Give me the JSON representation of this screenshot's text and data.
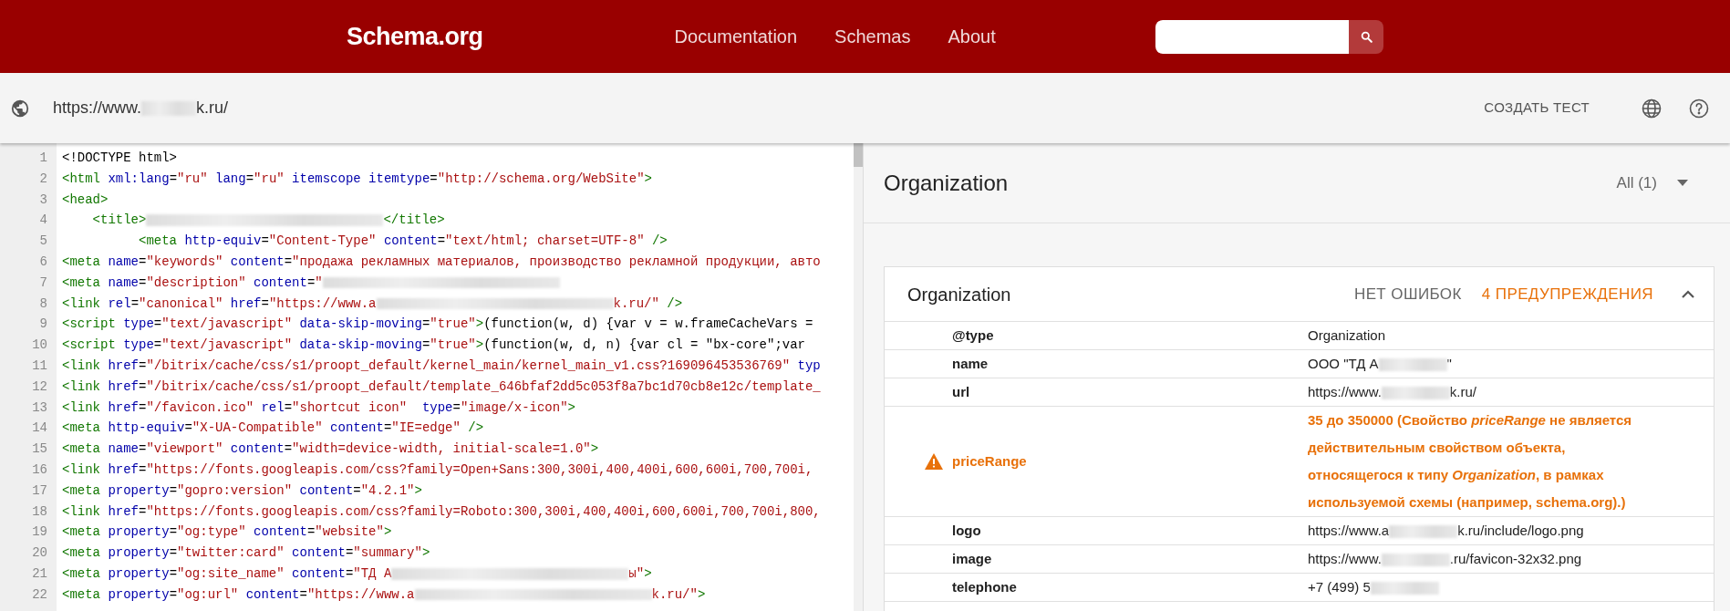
{
  "header": {
    "logo": "Schema.org",
    "nav": [
      {
        "label": "Documentation"
      },
      {
        "label": "Schemas"
      },
      {
        "label": "About"
      }
    ]
  },
  "toolbar": {
    "url": [
      {
        "kind": "text",
        "text": "https://www."
      },
      {
        "kind": "blur"
      },
      {
        "kind": "text",
        "text": "k.ru/"
      }
    ],
    "create_test": "СОЗДАТЬ ТЕСТ"
  },
  "code": {
    "lines": [
      {
        "number": "1",
        "tokens": [
          {
            "kind": "plain",
            "text": "<!DOCTYPE html>"
          }
        ]
      },
      {
        "number": "2",
        "tokens": [
          {
            "kind": "tag",
            "text": "<html"
          },
          {
            "kind": "attr",
            "text": " xml:lang"
          },
          {
            "kind": "plain",
            "text": "="
          },
          {
            "kind": "value",
            "text": "\"ru\""
          },
          {
            "kind": "attr",
            "text": " lang"
          },
          {
            "kind": "plain",
            "text": "="
          },
          {
            "kind": "value",
            "text": "\"ru\""
          },
          {
            "kind": "attr",
            "text": " itemscope"
          },
          {
            "kind": "attr",
            "text": " itemtype"
          },
          {
            "kind": "plain",
            "text": "="
          },
          {
            "kind": "value",
            "text": "\"http://schema.org/WebSite\""
          },
          {
            "kind": "tag",
            "text": ">"
          }
        ]
      },
      {
        "number": "3",
        "tokens": [
          {
            "kind": "tag",
            "text": "<head>"
          }
        ]
      },
      {
        "number": "4",
        "tokens": [
          {
            "kind": "tag",
            "text": "    <title>"
          },
          {
            "kind": "blur"
          },
          {
            "kind": "tag",
            "text": "</title>"
          }
        ]
      },
      {
        "number": "5",
        "tokens": [
          {
            "kind": "tag",
            "text": "          <meta"
          },
          {
            "kind": "attr",
            "text": " http-equiv"
          },
          {
            "kind": "plain",
            "text": "="
          },
          {
            "kind": "value",
            "text": "\"Content-Type\""
          },
          {
            "kind": "attr",
            "text": " content"
          },
          {
            "kind": "plain",
            "text": "="
          },
          {
            "kind": "value",
            "text": "\"text/html; charset=UTF-8\""
          },
          {
            "kind": "tag",
            "text": " />"
          }
        ]
      },
      {
        "number": "6",
        "tokens": [
          {
            "kind": "tag",
            "text": "<meta"
          },
          {
            "kind": "attr",
            "text": " name"
          },
          {
            "kind": "plain",
            "text": "="
          },
          {
            "kind": "value",
            "text": "\"keywords\""
          },
          {
            "kind": "attr",
            "text": " content"
          },
          {
            "kind": "plain",
            "text": "="
          },
          {
            "kind": "value",
            "text": "\"продажа рекламных материалов, производство рекламной продукции, авто"
          }
        ]
      },
      {
        "number": "7",
        "tokens": [
          {
            "kind": "tag",
            "text": "<meta"
          },
          {
            "kind": "attr",
            "text": " name"
          },
          {
            "kind": "plain",
            "text": "="
          },
          {
            "kind": "value",
            "text": "\"description\""
          },
          {
            "kind": "attr",
            "text": " content"
          },
          {
            "kind": "plain",
            "text": "="
          },
          {
            "kind": "value",
            "text": "\""
          },
          {
            "kind": "blur"
          }
        ]
      },
      {
        "number": "8",
        "tokens": [
          {
            "kind": "tag",
            "text": "<link"
          },
          {
            "kind": "attr",
            "text": " rel"
          },
          {
            "kind": "plain",
            "text": "="
          },
          {
            "kind": "value",
            "text": "\"canonical\""
          },
          {
            "kind": "attr",
            "text": " href"
          },
          {
            "kind": "plain",
            "text": "="
          },
          {
            "kind": "value",
            "text": "\"https://www.a"
          },
          {
            "kind": "blur"
          },
          {
            "kind": "value",
            "text": "k.ru/\""
          },
          {
            "kind": "tag",
            "text": " />"
          }
        ]
      },
      {
        "number": "9",
        "tokens": [
          {
            "kind": "tag",
            "text": "<script"
          },
          {
            "kind": "attr",
            "text": " type"
          },
          {
            "kind": "plain",
            "text": "="
          },
          {
            "kind": "value",
            "text": "\"text/javascript\""
          },
          {
            "kind": "attr",
            "text": " data-skip-moving"
          },
          {
            "kind": "plain",
            "text": "="
          },
          {
            "kind": "value",
            "text": "\"true\""
          },
          {
            "kind": "tag",
            "text": ">"
          },
          {
            "kind": "plain",
            "text": "(function(w, d) {var v = w.frameCacheVars ="
          }
        ]
      },
      {
        "number": "10",
        "tokens": [
          {
            "kind": "tag",
            "text": "<script"
          },
          {
            "kind": "attr",
            "text": " type"
          },
          {
            "kind": "plain",
            "text": "="
          },
          {
            "kind": "value",
            "text": "\"text/javascript\""
          },
          {
            "kind": "attr",
            "text": " data-skip-moving"
          },
          {
            "kind": "plain",
            "text": "="
          },
          {
            "kind": "value",
            "text": "\"true\""
          },
          {
            "kind": "tag",
            "text": ">"
          },
          {
            "kind": "plain",
            "text": "(function(w, d, n) {var cl = \"bx-core\";var"
          }
        ]
      },
      {
        "number": "11",
        "tokens": [
          {
            "kind": "tag",
            "text": "<link"
          },
          {
            "kind": "attr",
            "text": " href"
          },
          {
            "kind": "plain",
            "text": "="
          },
          {
            "kind": "value",
            "text": "\"/bitrix/cache/css/s1/proopt_default/kernel_main/kernel_main_v1.css?169096453536769\""
          },
          {
            "kind": "attr",
            "text": " typ"
          }
        ]
      },
      {
        "number": "12",
        "tokens": [
          {
            "kind": "tag",
            "text": "<link"
          },
          {
            "kind": "attr",
            "text": " href"
          },
          {
            "kind": "plain",
            "text": "="
          },
          {
            "kind": "value",
            "text": "\"/bitrix/cache/css/s1/proopt_default/template_646bfaf2dd5c053f8a7bc1d70cb8e12c/template_"
          }
        ]
      },
      {
        "number": "13",
        "tokens": [
          {
            "kind": "tag",
            "text": "<link"
          },
          {
            "kind": "attr",
            "text": " href"
          },
          {
            "kind": "plain",
            "text": "="
          },
          {
            "kind": "value",
            "text": "\"/favicon.ico\""
          },
          {
            "kind": "attr",
            "text": " rel"
          },
          {
            "kind": "plain",
            "text": "="
          },
          {
            "kind": "value",
            "text": "\"shortcut icon\""
          },
          {
            "kind": "attr",
            "text": "  type"
          },
          {
            "kind": "plain",
            "text": "="
          },
          {
            "kind": "value",
            "text": "\"image/x-icon\""
          },
          {
            "kind": "tag",
            "text": ">"
          }
        ]
      },
      {
        "number": "14",
        "tokens": [
          {
            "kind": "tag",
            "text": "<meta"
          },
          {
            "kind": "attr",
            "text": " http-equiv"
          },
          {
            "kind": "plain",
            "text": "="
          },
          {
            "kind": "value",
            "text": "\"X-UA-Compatible\""
          },
          {
            "kind": "attr",
            "text": " content"
          },
          {
            "kind": "plain",
            "text": "="
          },
          {
            "kind": "value",
            "text": "\"IE=edge\""
          },
          {
            "kind": "tag",
            "text": " />"
          }
        ]
      },
      {
        "number": "15",
        "tokens": [
          {
            "kind": "tag",
            "text": "<meta"
          },
          {
            "kind": "attr",
            "text": " name"
          },
          {
            "kind": "plain",
            "text": "="
          },
          {
            "kind": "value",
            "text": "\"viewport\""
          },
          {
            "kind": "attr",
            "text": " content"
          },
          {
            "kind": "plain",
            "text": "="
          },
          {
            "kind": "value",
            "text": "\"width=device-width, initial-scale=1.0\""
          },
          {
            "kind": "tag",
            "text": ">"
          }
        ]
      },
      {
        "number": "16",
        "tokens": [
          {
            "kind": "tag",
            "text": "<link"
          },
          {
            "kind": "attr",
            "text": " href"
          },
          {
            "kind": "plain",
            "text": "="
          },
          {
            "kind": "value",
            "text": "\"https://fonts.googleapis.com/css?family=Open+Sans:300,300i,400,400i,600,600i,700,700i,"
          }
        ]
      },
      {
        "number": "17",
        "tokens": [
          {
            "kind": "tag",
            "text": "<meta"
          },
          {
            "kind": "attr",
            "text": " property"
          },
          {
            "kind": "plain",
            "text": "="
          },
          {
            "kind": "value",
            "text": "\"gopro:version\""
          },
          {
            "kind": "attr",
            "text": " content"
          },
          {
            "kind": "plain",
            "text": "="
          },
          {
            "kind": "value",
            "text": "\"4.2.1\""
          },
          {
            "kind": "tag",
            "text": ">"
          }
        ]
      },
      {
        "number": "18",
        "tokens": [
          {
            "kind": "tag",
            "text": "<link"
          },
          {
            "kind": "attr",
            "text": " href"
          },
          {
            "kind": "plain",
            "text": "="
          },
          {
            "kind": "value",
            "text": "\"https://fonts.googleapis.com/css?family=Roboto:300,300i,400,400i,600,600i,700,700i,800,"
          }
        ]
      },
      {
        "number": "19",
        "tokens": [
          {
            "kind": "tag",
            "text": "<meta"
          },
          {
            "kind": "attr",
            "text": " property"
          },
          {
            "kind": "plain",
            "text": "="
          },
          {
            "kind": "value",
            "text": "\"og:type\""
          },
          {
            "kind": "attr",
            "text": " content"
          },
          {
            "kind": "plain",
            "text": "="
          },
          {
            "kind": "value",
            "text": "\"website\""
          },
          {
            "kind": "tag",
            "text": ">"
          }
        ]
      },
      {
        "number": "20",
        "tokens": [
          {
            "kind": "tag",
            "text": "<meta"
          },
          {
            "kind": "attr",
            "text": " property"
          },
          {
            "kind": "plain",
            "text": "="
          },
          {
            "kind": "value",
            "text": "\"twitter:card\""
          },
          {
            "kind": "attr",
            "text": " content"
          },
          {
            "kind": "plain",
            "text": "="
          },
          {
            "kind": "value",
            "text": "\"summary\""
          },
          {
            "kind": "tag",
            "text": ">"
          }
        ]
      },
      {
        "number": "21",
        "tokens": [
          {
            "kind": "tag",
            "text": "<meta"
          },
          {
            "kind": "attr",
            "text": " property"
          },
          {
            "kind": "plain",
            "text": "="
          },
          {
            "kind": "value",
            "text": "\"og:site_name\""
          },
          {
            "kind": "attr",
            "text": " content"
          },
          {
            "kind": "plain",
            "text": "="
          },
          {
            "kind": "value",
            "text": "\"ТД А"
          },
          {
            "kind": "blur"
          },
          {
            "kind": "value",
            "text": "ы\""
          },
          {
            "kind": "tag",
            "text": ">"
          }
        ]
      },
      {
        "number": "22",
        "tokens": [
          {
            "kind": "tag",
            "text": "<meta"
          },
          {
            "kind": "attr",
            "text": " property"
          },
          {
            "kind": "plain",
            "text": "="
          },
          {
            "kind": "value",
            "text": "\"og:url\""
          },
          {
            "kind": "attr",
            "text": " content"
          },
          {
            "kind": "plain",
            "text": "="
          },
          {
            "kind": "value",
            "text": "\"https://www.a"
          },
          {
            "kind": "blur"
          },
          {
            "kind": "value",
            "text": "k.ru/\""
          },
          {
            "kind": "tag",
            "text": ">"
          }
        ]
      }
    ]
  },
  "results": {
    "title": "Organization",
    "filter": "All (1)",
    "item": {
      "title": "Organization",
      "errors": "НЕТ ОШИБОК",
      "warnings": "4 ПРЕДУПРЕЖДЕНИЯ",
      "expanded": true,
      "rows": [
        {
          "key": "@type",
          "warning": false,
          "value": [
            {
              "kind": "text",
              "text": "Organization"
            }
          ]
        },
        {
          "key": "name",
          "warning": false,
          "value": [
            {
              "kind": "text",
              "text": "ООО \"ТД А"
            },
            {
              "kind": "blur"
            },
            {
              "kind": "text",
              "text": "\""
            }
          ]
        },
        {
          "key": "url",
          "warning": false,
          "value": [
            {
              "kind": "text",
              "text": "https://www."
            },
            {
              "kind": "blur"
            },
            {
              "kind": "text",
              "text": "k.ru/"
            }
          ]
        },
        {
          "key": "priceRange",
          "warning": true,
          "value": [
            {
              "kind": "text",
              "text": "35 до 350000 (Свойство *priceRange* не является действительным свойством объекта, относящегося к типу *Organization*, в рамках используемой схемы (например, schema.org).)"
            }
          ]
        },
        {
          "key": "logo",
          "warning": false,
          "value": [
            {
              "kind": "text",
              "text": "https://www.a"
            },
            {
              "kind": "blur"
            },
            {
              "kind": "text",
              "text": "k.ru/include/logo.png"
            }
          ]
        },
        {
          "key": "image",
          "warning": false,
          "value": [
            {
              "kind": "text",
              "text": "https://www."
            },
            {
              "kind": "blur"
            },
            {
              "kind": "text",
              "text": ".ru/favicon-32x32.png"
            }
          ]
        },
        {
          "key": "telephone",
          "warning": false,
          "value": [
            {
              "kind": "text",
              "text": "+7 (499) 5"
            },
            {
              "kind": "blur"
            }
          ]
        }
      ]
    }
  }
}
